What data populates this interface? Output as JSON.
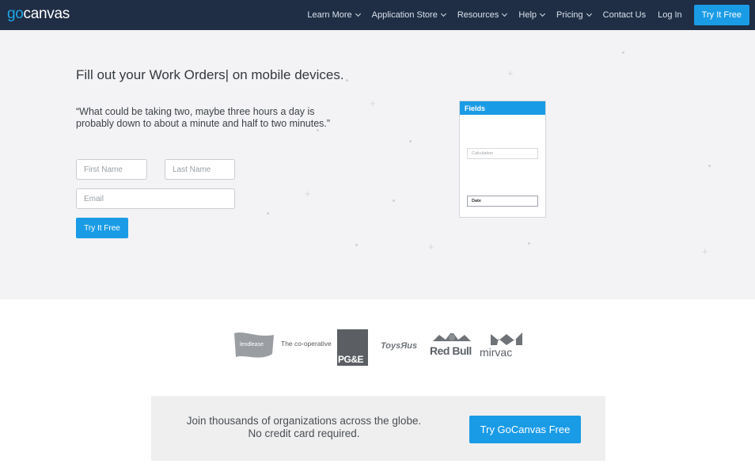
{
  "nav": {
    "logo_go": "go",
    "logo_canvas": "canvas",
    "items": [
      {
        "label": "Learn More",
        "icon": "chevron-down-icon"
      },
      {
        "label": "Application Store",
        "icon": "chevron-down-icon"
      },
      {
        "label": "Resources",
        "icon": "chevron-down-icon"
      },
      {
        "label": "Help",
        "icon": "chevron-down-icon"
      },
      {
        "label": "Pricing",
        "icon": "chevron-down-icon"
      },
      {
        "label": "Contact Us"
      },
      {
        "label": "Log In"
      }
    ],
    "cta_label": "Try It Free"
  },
  "hero": {
    "headline": "Fill out your Work Orders| on mobile devices.",
    "quote": "“What could be taking two, maybe three hours a day is probably down to about a minute and half to two minutes.”",
    "form": {
      "first_name_placeholder": "First Name",
      "last_name_placeholder": "Last Name",
      "email_placeholder": "Email",
      "submit_label": "Try It Free"
    },
    "phone": {
      "header": "Fields",
      "field_calculation": "Calculation",
      "field_date": "Date"
    }
  },
  "logos": {
    "lendlease": "lendlease",
    "coop": "The co-operative",
    "pge": "PG&E",
    "toysrus": "ToysЯus",
    "redbull": "Red Bull",
    "mirvac": "mirvac"
  },
  "cta": {
    "line1": "Join thousands of organizations across the globe.",
    "line2": "No credit card required.",
    "button_label": "Try GoCanvas Free"
  },
  "colors": {
    "nav_bg": "#1f2e45",
    "accent": "#1a9be6",
    "hero_bg": "#f3f3f5"
  }
}
